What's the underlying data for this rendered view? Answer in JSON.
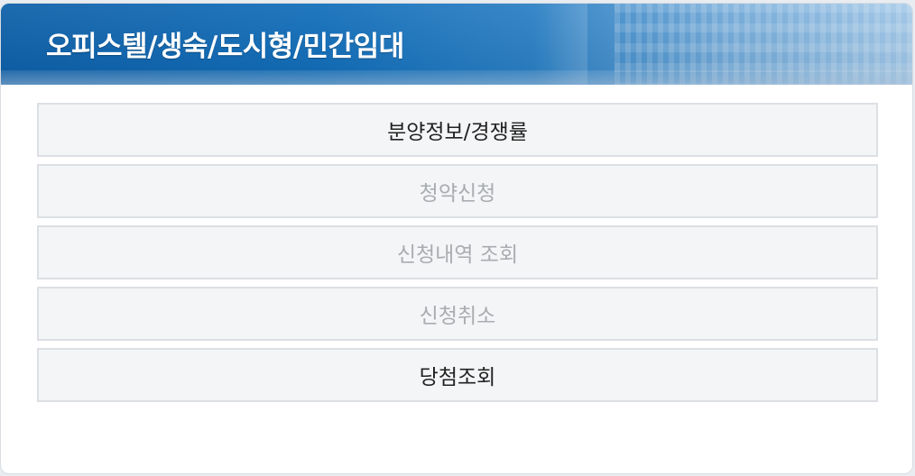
{
  "header": {
    "title": "오피스텔/생숙/도시형/민간임대"
  },
  "menu": {
    "items": [
      {
        "label": "분양정보/경쟁률",
        "enabled": true
      },
      {
        "label": "청약신청",
        "enabled": false
      },
      {
        "label": "신청내역 조회",
        "enabled": false
      },
      {
        "label": "신청취소",
        "enabled": false
      },
      {
        "label": "당첨조회",
        "enabled": true
      }
    ]
  },
  "colors": {
    "header_blue": "#0f6cb8",
    "button_bg": "#f4f5f7",
    "enabled_text": "#222222",
    "disabled_text": "#a9acb0"
  }
}
